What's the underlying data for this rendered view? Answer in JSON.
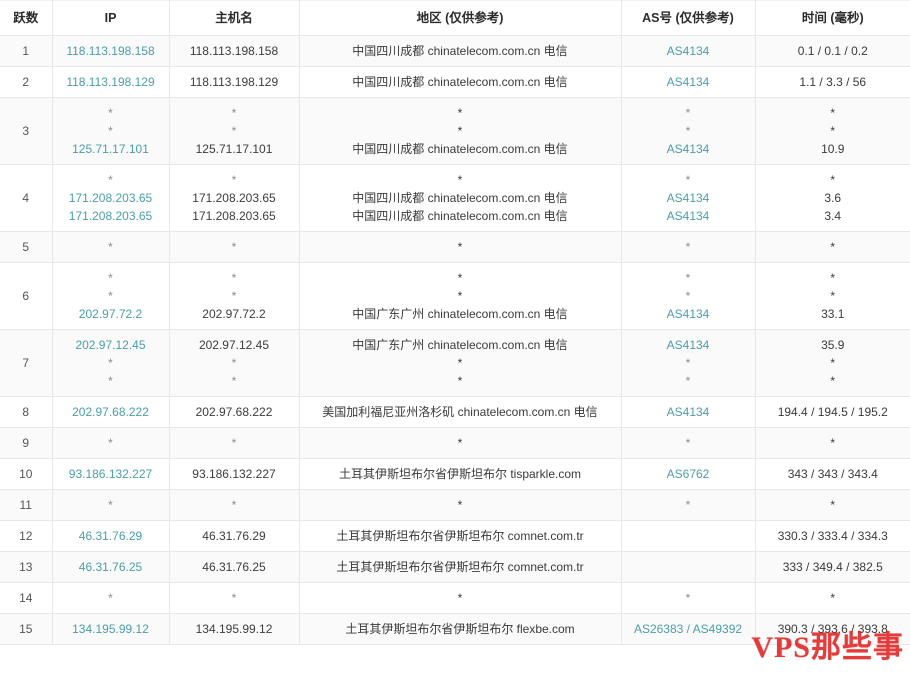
{
  "table": {
    "headers": [
      {
        "label": "跃数",
        "key": "hop"
      },
      {
        "label": "IP",
        "key": "ip"
      },
      {
        "label": "主机名",
        "key": "host"
      },
      {
        "label": "地区 (仅供参考)",
        "key": "geo"
      },
      {
        "label": "AS号 (仅供参考)",
        "key": "as"
      },
      {
        "label": "时间 (毫秒)",
        "key": "time"
      }
    ],
    "colors": {
      "link": "#4a9ea8",
      "text": "#3a3a3a",
      "star": "#8c8c8c",
      "row_odd_bg": "#fafafa",
      "row_even_bg": "#ffffff",
      "border": "#e8e8e8",
      "watermark": "#e01b1b"
    },
    "rows": [
      {
        "hop": "1",
        "ip": [
          {
            "text": "118.113.198.158",
            "style": "link"
          }
        ],
        "host": [
          {
            "text": "118.113.198.158",
            "style": "plain"
          }
        ],
        "geo": [
          {
            "text": "中国四川成都 chinatelecom.com.cn 电信",
            "style": "plain"
          }
        ],
        "as": [
          {
            "text": "AS4134",
            "style": "link"
          }
        ],
        "time": [
          {
            "text": "0.1 / 0.1 / 0.2",
            "style": "plain"
          }
        ]
      },
      {
        "hop": "2",
        "ip": [
          {
            "text": "118.113.198.129",
            "style": "link"
          }
        ],
        "host": [
          {
            "text": "118.113.198.129",
            "style": "plain"
          }
        ],
        "geo": [
          {
            "text": "中国四川成都 chinatelecom.com.cn 电信",
            "style": "plain"
          }
        ],
        "as": [
          {
            "text": "AS4134",
            "style": "link"
          }
        ],
        "time": [
          {
            "text": "1.1 / 3.3 / 56",
            "style": "plain"
          }
        ]
      },
      {
        "hop": "3",
        "ip": [
          {
            "text": "*",
            "style": "star"
          },
          {
            "text": "*",
            "style": "star"
          },
          {
            "text": "125.71.17.101",
            "style": "link"
          }
        ],
        "host": [
          {
            "text": "*",
            "style": "star"
          },
          {
            "text": "*",
            "style": "star"
          },
          {
            "text": "125.71.17.101",
            "style": "plain"
          }
        ],
        "geo": [
          {
            "text": "*",
            "style": "star"
          },
          {
            "text": "*",
            "style": "star"
          },
          {
            "text": "中国四川成都 chinatelecom.com.cn 电信",
            "style": "plain"
          }
        ],
        "as": [
          {
            "text": "*",
            "style": "star"
          },
          {
            "text": "*",
            "style": "star"
          },
          {
            "text": "AS4134",
            "style": "link"
          }
        ],
        "time": [
          {
            "text": "*",
            "style": "star"
          },
          {
            "text": "*",
            "style": "star"
          },
          {
            "text": "10.9",
            "style": "plain"
          }
        ]
      },
      {
        "hop": "4",
        "ip": [
          {
            "text": "*",
            "style": "star"
          },
          {
            "text": "171.208.203.65",
            "style": "link"
          },
          {
            "text": "171.208.203.65",
            "style": "link"
          }
        ],
        "host": [
          {
            "text": "*",
            "style": "star"
          },
          {
            "text": "171.208.203.65",
            "style": "plain"
          },
          {
            "text": "171.208.203.65",
            "style": "plain"
          }
        ],
        "geo": [
          {
            "text": "*",
            "style": "star"
          },
          {
            "text": "中国四川成都 chinatelecom.com.cn 电信",
            "style": "plain"
          },
          {
            "text": "中国四川成都 chinatelecom.com.cn 电信",
            "style": "plain"
          }
        ],
        "as": [
          {
            "text": "*",
            "style": "star"
          },
          {
            "text": "AS4134",
            "style": "link"
          },
          {
            "text": "AS4134",
            "style": "link"
          }
        ],
        "time": [
          {
            "text": "*",
            "style": "star"
          },
          {
            "text": "3.6",
            "style": "plain"
          },
          {
            "text": "3.4",
            "style": "plain"
          }
        ]
      },
      {
        "hop": "5",
        "ip": [
          {
            "text": "*",
            "style": "star"
          }
        ],
        "host": [
          {
            "text": "*",
            "style": "star"
          }
        ],
        "geo": [
          {
            "text": "*",
            "style": "star"
          }
        ],
        "as": [
          {
            "text": "*",
            "style": "star"
          }
        ],
        "time": [
          {
            "text": "*",
            "style": "star"
          }
        ]
      },
      {
        "hop": "6",
        "ip": [
          {
            "text": "*",
            "style": "star"
          },
          {
            "text": "*",
            "style": "star"
          },
          {
            "text": "202.97.72.2",
            "style": "link"
          }
        ],
        "host": [
          {
            "text": "*",
            "style": "star"
          },
          {
            "text": "*",
            "style": "star"
          },
          {
            "text": "202.97.72.2",
            "style": "plain"
          }
        ],
        "geo": [
          {
            "text": "*",
            "style": "star"
          },
          {
            "text": "*",
            "style": "star"
          },
          {
            "text": "中国广东广州 chinatelecom.com.cn 电信",
            "style": "plain"
          }
        ],
        "as": [
          {
            "text": "*",
            "style": "star"
          },
          {
            "text": "*",
            "style": "star"
          },
          {
            "text": "AS4134",
            "style": "link"
          }
        ],
        "time": [
          {
            "text": "*",
            "style": "star"
          },
          {
            "text": "*",
            "style": "star"
          },
          {
            "text": "33.1",
            "style": "plain"
          }
        ]
      },
      {
        "hop": "7",
        "ip": [
          {
            "text": "202.97.12.45",
            "style": "link"
          },
          {
            "text": "*",
            "style": "star"
          },
          {
            "text": "*",
            "style": "star"
          }
        ],
        "host": [
          {
            "text": "202.97.12.45",
            "style": "plain"
          },
          {
            "text": "*",
            "style": "star"
          },
          {
            "text": "*",
            "style": "star"
          }
        ],
        "geo": [
          {
            "text": "中国广东广州 chinatelecom.com.cn 电信",
            "style": "plain"
          },
          {
            "text": "*",
            "style": "star"
          },
          {
            "text": "*",
            "style": "star"
          }
        ],
        "as": [
          {
            "text": "AS4134",
            "style": "link"
          },
          {
            "text": "*",
            "style": "star"
          },
          {
            "text": "*",
            "style": "star"
          }
        ],
        "time": [
          {
            "text": "35.9",
            "style": "plain"
          },
          {
            "text": "*",
            "style": "star"
          },
          {
            "text": "*",
            "style": "star"
          }
        ]
      },
      {
        "hop": "8",
        "ip": [
          {
            "text": "202.97.68.222",
            "style": "link"
          }
        ],
        "host": [
          {
            "text": "202.97.68.222",
            "style": "plain"
          }
        ],
        "geo": [
          {
            "text": "美国加利福尼亚州洛杉矶 chinatelecom.com.cn 电信",
            "style": "plain"
          }
        ],
        "as": [
          {
            "text": "AS4134",
            "style": "link"
          }
        ],
        "time": [
          {
            "text": "194.4 / 194.5 / 195.2",
            "style": "plain"
          }
        ]
      },
      {
        "hop": "9",
        "ip": [
          {
            "text": "*",
            "style": "star"
          }
        ],
        "host": [
          {
            "text": "*",
            "style": "star"
          }
        ],
        "geo": [
          {
            "text": "*",
            "style": "star"
          }
        ],
        "as": [
          {
            "text": "*",
            "style": "star"
          }
        ],
        "time": [
          {
            "text": "*",
            "style": "star"
          }
        ]
      },
      {
        "hop": "10",
        "ip": [
          {
            "text": "93.186.132.227",
            "style": "link"
          }
        ],
        "host": [
          {
            "text": "93.186.132.227",
            "style": "plain"
          }
        ],
        "geo": [
          {
            "text": "土耳其伊斯坦布尔省伊斯坦布尔 tisparkle.com",
            "style": "plain"
          }
        ],
        "as": [
          {
            "text": "AS6762",
            "style": "link"
          }
        ],
        "time": [
          {
            "text": "343 / 343 / 343.4",
            "style": "plain"
          }
        ]
      },
      {
        "hop": "11",
        "ip": [
          {
            "text": "*",
            "style": "star"
          }
        ],
        "host": [
          {
            "text": "*",
            "style": "star"
          }
        ],
        "geo": [
          {
            "text": "*",
            "style": "star"
          }
        ],
        "as": [
          {
            "text": "*",
            "style": "star"
          }
        ],
        "time": [
          {
            "text": "*",
            "style": "star"
          }
        ]
      },
      {
        "hop": "12",
        "ip": [
          {
            "text": "46.31.76.29",
            "style": "link"
          }
        ],
        "host": [
          {
            "text": "46.31.76.29",
            "style": "plain"
          }
        ],
        "geo": [
          {
            "text": "土耳其伊斯坦布尔省伊斯坦布尔 comnet.com.tr",
            "style": "plain"
          }
        ],
        "as": [],
        "time": [
          {
            "text": "330.3 / 333.4 / 334.3",
            "style": "plain"
          }
        ]
      },
      {
        "hop": "13",
        "ip": [
          {
            "text": "46.31.76.25",
            "style": "link"
          }
        ],
        "host": [
          {
            "text": "46.31.76.25",
            "style": "plain"
          }
        ],
        "geo": [
          {
            "text": "土耳其伊斯坦布尔省伊斯坦布尔 comnet.com.tr",
            "style": "plain"
          }
        ],
        "as": [],
        "time": [
          {
            "text": "333 / 349.4 / 382.5",
            "style": "plain"
          }
        ]
      },
      {
        "hop": "14",
        "ip": [
          {
            "text": "*",
            "style": "star"
          }
        ],
        "host": [
          {
            "text": "*",
            "style": "star"
          }
        ],
        "geo": [
          {
            "text": "*",
            "style": "star"
          }
        ],
        "as": [
          {
            "text": "*",
            "style": "star"
          }
        ],
        "time": [
          {
            "text": "*",
            "style": "star"
          }
        ]
      },
      {
        "hop": "15",
        "ip": [
          {
            "text": "134.195.99.12",
            "style": "link"
          }
        ],
        "host": [
          {
            "text": "134.195.99.12",
            "style": "plain"
          }
        ],
        "geo": [
          {
            "text": "土耳其伊斯坦布尔省伊斯坦布尔 flexbe.com",
            "style": "plain"
          }
        ],
        "as": [
          {
            "text": "AS26383 / AS49392",
            "style": "link"
          }
        ],
        "time": [
          {
            "text": "390.3 / 393.6 / 393.8",
            "style": "plain"
          }
        ]
      }
    ]
  },
  "watermark": {
    "text": "VPS那些事"
  }
}
